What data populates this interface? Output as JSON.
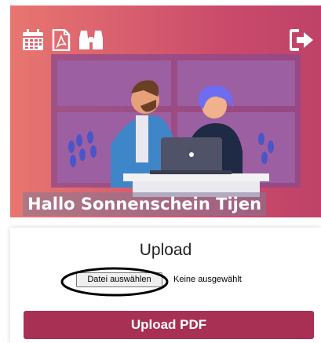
{
  "header": {
    "icons": [
      "calendar-icon",
      "pdf-file-icon",
      "binoculars-icon",
      "logout-icon"
    ],
    "greeting": "Hallo Sonnenschein Tijen"
  },
  "upload": {
    "title": "Upload",
    "file_button_label": "Datei auswählen",
    "file_status": "Keine ausgewählt",
    "submit_label": "Upload PDF"
  },
  "colors": {
    "hero_gradient_start": "#e8766f",
    "hero_gradient_end": "#bf4268",
    "accent_button": "#a83054"
  }
}
